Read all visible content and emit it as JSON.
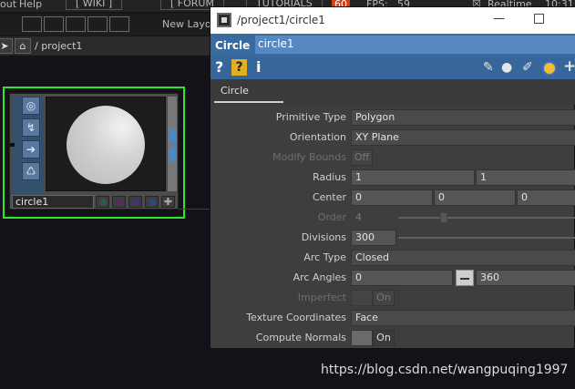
{
  "menubar": {
    "items": [
      "out",
      "Help",
      "[ WIKI ]",
      "[ FORUM",
      "TUTORIALS",
      "60",
      "FPS:",
      "59",
      "Realtime",
      "10:31"
    ],
    "new_layout": "New Layo"
  },
  "network": {
    "path": "/ project1",
    "node": {
      "name": "circle1"
    }
  },
  "param_window": {
    "title": "/project1/circle1",
    "op_type": "Circle",
    "op_name": "circle1",
    "page_tab": "Circle",
    "params": {
      "primitive_type": {
        "label": "Primitive Type",
        "value": "Polygon"
      },
      "orientation": {
        "label": "Orientation",
        "value": "XY Plane"
      },
      "modify_bounds": {
        "label": "Modify Bounds",
        "value": "Off"
      },
      "radius": {
        "label": "Radius",
        "x": "1",
        "y": "1"
      },
      "center": {
        "label": "Center",
        "x": "0",
        "y": "0",
        "z": "0"
      },
      "order": {
        "label": "Order",
        "value": "4"
      },
      "divisions": {
        "label": "Divisions",
        "value": "300"
      },
      "arc_type": {
        "label": "Arc Type",
        "value": "Closed"
      },
      "arc_angles": {
        "label": "Arc Angles",
        "start": "0",
        "end": "360"
      },
      "imperfect": {
        "label": "Imperfect",
        "value": "On"
      },
      "texture_coordinates": {
        "label": "Texture Coordinates",
        "value": "Face"
      },
      "compute_normals": {
        "label": "Compute Normals",
        "value": "On"
      }
    }
  },
  "watermark": "https://blog.csdn.net/wangpuqing1997",
  "colors": {
    "node_outline": "#2ee62e",
    "header_blue": "#3a6b9f",
    "window_bg": "#3e3e3e"
  }
}
